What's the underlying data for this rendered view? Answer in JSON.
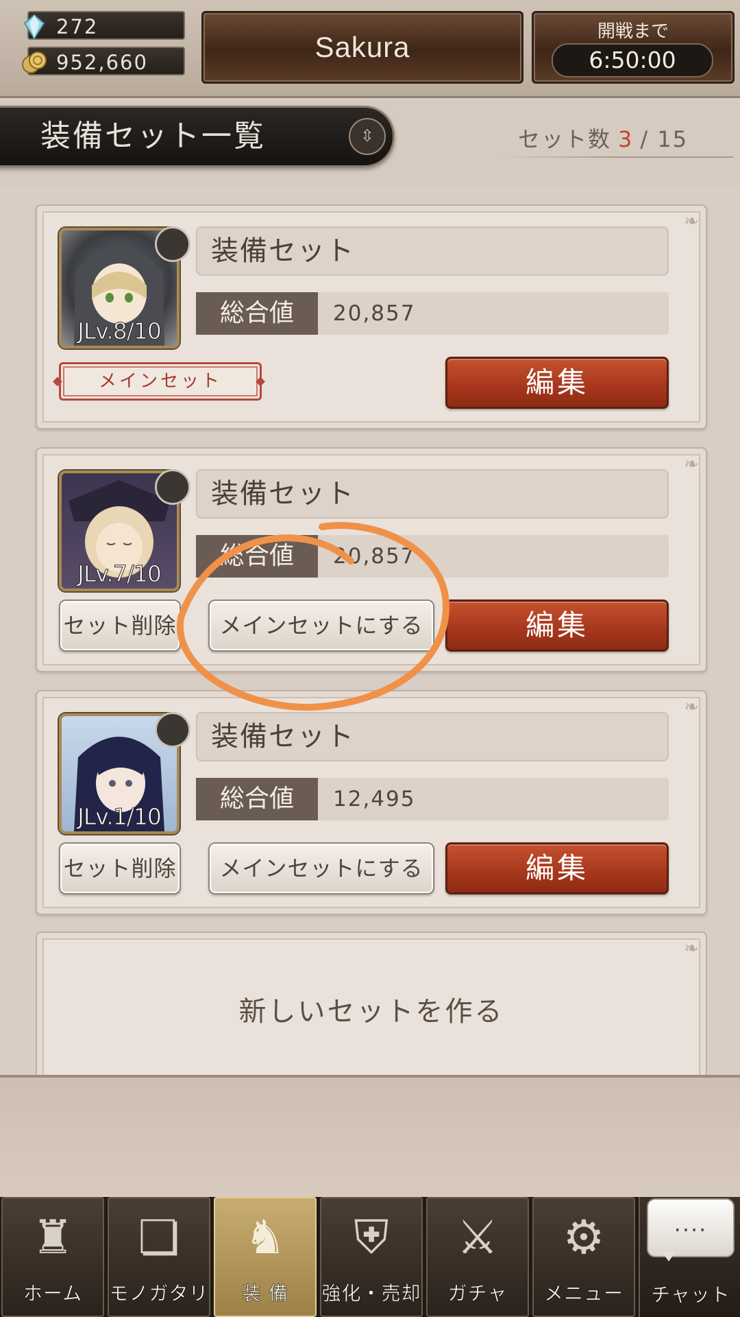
{
  "resources": {
    "gems": "272",
    "gold": "952,660"
  },
  "player_name": "Sakura",
  "battle_timer": {
    "label": "開戦まで",
    "value": "6:50:00"
  },
  "header": {
    "title": "装備セット一覧",
    "set_count_label": "セット数",
    "set_count_current": "3",
    "set_count_sep": "/",
    "set_count_max": "15"
  },
  "sets": [
    {
      "name": "装備セット",
      "stat_label": "総合値",
      "stat_value": "20,857",
      "job_level": "JLv.8/10",
      "is_main": true,
      "main_label": "メインセット",
      "edit_label": "編集"
    },
    {
      "name": "装備セット",
      "stat_label": "総合値",
      "stat_value": "20,857",
      "job_level": "JLv.7/10",
      "is_main": false,
      "delete_label": "セット削除",
      "make_main_label": "メインセットにする",
      "edit_label": "編集"
    },
    {
      "name": "装備セット",
      "stat_label": "総合値",
      "stat_value": "12,495",
      "job_level": "JLv.1/10",
      "is_main": false,
      "delete_label": "セット削除",
      "make_main_label": "メインセットにする",
      "edit_label": "編集"
    }
  ],
  "new_set_label": "新しいセットを作る",
  "nav": {
    "items": [
      {
        "label": "ホーム",
        "icon": "castle-icon"
      },
      {
        "label": "モノガタリ",
        "icon": "book-icon"
      },
      {
        "label": "装 備",
        "icon": "marionette-icon",
        "active": true
      },
      {
        "label": "強化・売却",
        "icon": "shield-icon"
      },
      {
        "label": "ガチャ",
        "icon": "swords-icon"
      },
      {
        "label": "メニュー",
        "icon": "gear-icon"
      }
    ],
    "chat_label": "チャット",
    "chat_bubble": "...."
  },
  "colors": {
    "accent_red": "#a6361c",
    "count_highlight": "#c2452a",
    "annotation": "#f0914a"
  }
}
